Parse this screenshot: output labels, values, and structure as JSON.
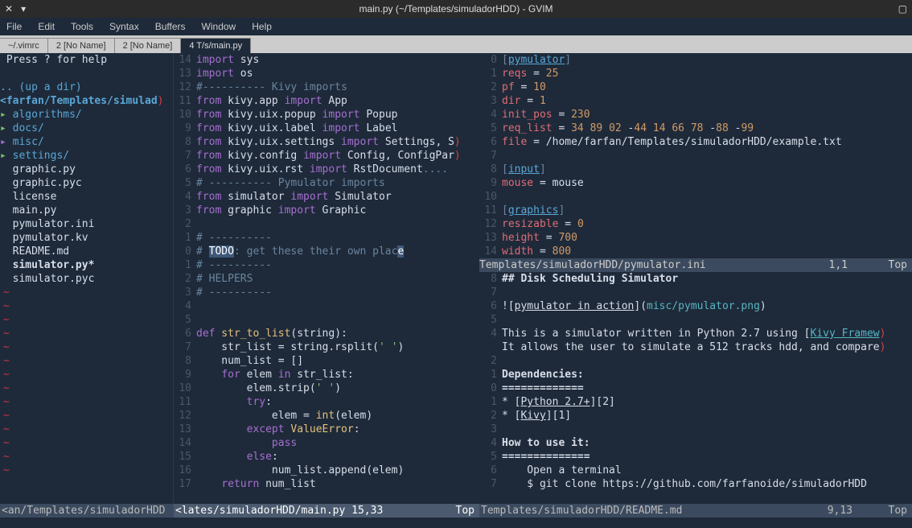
{
  "title": "main.py (~/Templates/simuladorHDD) - GVIM",
  "menus": [
    "File",
    "Edit",
    "Tools",
    "Syntax",
    "Buffers",
    "Window",
    "Help"
  ],
  "tabs": [
    "~/.vimrc",
    "2 [No Name]",
    "2 [No Name]",
    "4 T/s/main.py"
  ],
  "nerdtree": {
    "header": " Press ? for help",
    "updir": ".. (up a dir)",
    "path": "<farfan/Templates/simulad",
    "tree": [
      {
        "icon": "▸",
        "name": "algorithms/",
        "color": "blue",
        "iconcolor": "green"
      },
      {
        "icon": "▸",
        "name": "docs/",
        "color": "blue",
        "iconcolor": "green"
      },
      {
        "icon": "▸",
        "name": "misc/",
        "color": "blue",
        "iconcolor": "purple"
      },
      {
        "icon": "▸",
        "name": "settings/",
        "color": "blue",
        "iconcolor": "green"
      },
      {
        "icon": " ",
        "name": "graphic.py",
        "color": "white"
      },
      {
        "icon": " ",
        "name": "graphic.pyc",
        "color": "white"
      },
      {
        "icon": " ",
        "name": "license",
        "color": "white"
      },
      {
        "icon": " ",
        "name": "main.py",
        "color": "white"
      },
      {
        "icon": " ",
        "name": "pymulator.ini",
        "color": "white"
      },
      {
        "icon": " ",
        "name": "pymulator.kv",
        "color": "white"
      },
      {
        "icon": " ",
        "name": "README.md",
        "color": "white"
      },
      {
        "icon": " ",
        "name": "simulator.py*",
        "bold": true,
        "color": "white"
      },
      {
        "icon": " ",
        "name": "simulator.pyc",
        "color": "white"
      }
    ]
  },
  "main_code": [
    {
      "n": "14",
      "tokens": [
        [
          "purple",
          "import"
        ],
        [
          "white",
          " sys"
        ]
      ]
    },
    {
      "n": "13",
      "tokens": [
        [
          "purple",
          "import"
        ],
        [
          "white",
          " os"
        ]
      ]
    },
    {
      "n": "12",
      "tokens": [
        [
          "gray",
          "#---------- Kivy imports"
        ]
      ]
    },
    {
      "n": "11",
      "tokens": [
        [
          "purple",
          "from"
        ],
        [
          "white",
          " kivy.app "
        ],
        [
          "purple",
          "import"
        ],
        [
          "white",
          " App"
        ]
      ]
    },
    {
      "n": "10",
      "tokens": [
        [
          "purple",
          "from"
        ],
        [
          "white",
          " kivy.uix.popup "
        ],
        [
          "purple",
          "import"
        ],
        [
          "white",
          " Popup"
        ]
      ]
    },
    {
      "n": "9",
      "tokens": [
        [
          "purple",
          "from"
        ],
        [
          "white",
          " kivy.uix.label "
        ],
        [
          "purple",
          "import"
        ],
        [
          "white",
          " Label"
        ]
      ]
    },
    {
      "n": "8",
      "tokens": [
        [
          "purple",
          "from"
        ],
        [
          "white",
          " kivy.uix.settings "
        ],
        [
          "purple",
          "import"
        ],
        [
          "white",
          " Settings, S"
        ],
        [
          "rmark",
          ")"
        ]
      ]
    },
    {
      "n": "7",
      "tokens": [
        [
          "purple",
          "from"
        ],
        [
          "white",
          " kivy.config "
        ],
        [
          "purple",
          "import"
        ],
        [
          "white",
          " Config, ConfigPar"
        ],
        [
          "rmark",
          ")"
        ]
      ]
    },
    {
      "n": "6",
      "tokens": [
        [
          "purple",
          "from"
        ],
        [
          "white",
          " kivy.uix.rst "
        ],
        [
          "purple",
          "import"
        ],
        [
          "white",
          " RstDocument"
        ],
        [
          "gray",
          "...."
        ]
      ]
    },
    {
      "n": "5",
      "tokens": [
        [
          "gray",
          "# ---------- Pymulator imports"
        ]
      ]
    },
    {
      "n": "4",
      "tokens": [
        [
          "purple",
          "from"
        ],
        [
          "white",
          " simulator "
        ],
        [
          "purple",
          "import"
        ],
        [
          "white",
          " Simulator"
        ]
      ]
    },
    {
      "n": "3",
      "tokens": [
        [
          "purple",
          "from"
        ],
        [
          "white",
          " graphic "
        ],
        [
          "purple",
          "import"
        ],
        [
          "white",
          " Graphic"
        ]
      ]
    },
    {
      "n": "2",
      "tokens": []
    },
    {
      "n": "1",
      "tokens": [
        [
          "gray",
          "# ----------"
        ]
      ]
    },
    {
      "n": "0",
      "tokens": [
        [
          "gray",
          "# "
        ],
        [
          "sel",
          "TODO"
        ],
        [
          "gray",
          ": get these their own plac"
        ],
        [
          "sel",
          "e"
        ]
      ]
    },
    {
      "n": "1",
      "tokens": [
        [
          "gray",
          "# ----------"
        ]
      ]
    },
    {
      "n": "2",
      "tokens": [
        [
          "gray",
          "# HELPERS"
        ]
      ]
    },
    {
      "n": "3",
      "tokens": [
        [
          "gray",
          "# ----------"
        ]
      ]
    },
    {
      "n": "4",
      "tokens": []
    },
    {
      "n": "5",
      "tokens": []
    },
    {
      "n": "6",
      "tokens": [
        [
          "purple",
          "def"
        ],
        [
          "yellow",
          " str_to_list"
        ],
        [
          "white",
          "(string):"
        ]
      ]
    },
    {
      "n": "7",
      "tokens": [
        [
          "white",
          "    str_list = string.rsplit("
        ],
        [
          "green",
          "' '"
        ],
        [
          "white",
          ")"
        ]
      ]
    },
    {
      "n": "8",
      "tokens": [
        [
          "white",
          "    num_list = []"
        ]
      ]
    },
    {
      "n": "9",
      "tokens": [
        [
          "white",
          "    "
        ],
        [
          "purple",
          "for"
        ],
        [
          "white",
          " elem "
        ],
        [
          "purple",
          "in"
        ],
        [
          "white",
          " str_list:"
        ]
      ]
    },
    {
      "n": "10",
      "tokens": [
        [
          "white",
          "        elem.strip("
        ],
        [
          "green",
          "' '"
        ],
        [
          "white",
          ")"
        ]
      ]
    },
    {
      "n": "11",
      "tokens": [
        [
          "white",
          "        "
        ],
        [
          "purple",
          "try"
        ],
        [
          "white",
          ":"
        ]
      ]
    },
    {
      "n": "12",
      "tokens": [
        [
          "white",
          "            elem = "
        ],
        [
          "yellow",
          "int"
        ],
        [
          "white",
          "(elem)"
        ]
      ]
    },
    {
      "n": "13",
      "tokens": [
        [
          "white",
          "        "
        ],
        [
          "purple",
          "except"
        ],
        [
          "yellow",
          " ValueError"
        ],
        [
          "white",
          ":"
        ]
      ]
    },
    {
      "n": "14",
      "tokens": [
        [
          "white",
          "            "
        ],
        [
          "purple",
          "pass"
        ]
      ]
    },
    {
      "n": "15",
      "tokens": [
        [
          "white",
          "        "
        ],
        [
          "purple",
          "else"
        ],
        [
          "white",
          ":"
        ]
      ]
    },
    {
      "n": "16",
      "tokens": [
        [
          "white",
          "            num_list.append(elem)"
        ]
      ]
    },
    {
      "n": "17",
      "tokens": [
        [
          "white",
          "    "
        ],
        [
          "purple",
          "return"
        ],
        [
          "white",
          " num_list"
        ]
      ]
    }
  ],
  "ini_code": [
    {
      "n": "0",
      "tokens": [
        [
          "gray",
          "["
        ],
        [
          "blue underline",
          "pymulator"
        ],
        [
          "gray",
          "]"
        ]
      ]
    },
    {
      "n": "1",
      "tokens": [
        [
          "red",
          "reqs"
        ],
        [
          "white",
          " = "
        ],
        [
          "orange",
          "25"
        ]
      ]
    },
    {
      "n": "2",
      "tokens": [
        [
          "red",
          "pf"
        ],
        [
          "white",
          " = "
        ],
        [
          "orange",
          "10"
        ]
      ]
    },
    {
      "n": "3",
      "tokens": [
        [
          "red",
          "dir"
        ],
        [
          "white",
          " = "
        ],
        [
          "orange",
          "1"
        ]
      ]
    },
    {
      "n": "4",
      "tokens": [
        [
          "red",
          "init_pos"
        ],
        [
          "white",
          " = "
        ],
        [
          "orange",
          "230"
        ]
      ]
    },
    {
      "n": "5",
      "tokens": [
        [
          "red",
          "req_list"
        ],
        [
          "white",
          " = "
        ],
        [
          "orange",
          "34 89 02"
        ],
        [
          "white",
          " -"
        ],
        [
          "orange",
          "44 14 66 78"
        ],
        [
          "white",
          " -"
        ],
        [
          "orange",
          "88"
        ],
        [
          "white",
          " -"
        ],
        [
          "orange",
          "99"
        ]
      ]
    },
    {
      "n": "6",
      "tokens": [
        [
          "red",
          "file"
        ],
        [
          "white",
          " = /home/farfan/Templates/simuladorHDD/example.txt"
        ]
      ]
    },
    {
      "n": "7",
      "tokens": []
    },
    {
      "n": "8",
      "tokens": [
        [
          "gray",
          "["
        ],
        [
          "blue underline",
          "input"
        ],
        [
          "gray",
          "]"
        ]
      ]
    },
    {
      "n": "9",
      "tokens": [
        [
          "red",
          "mouse"
        ],
        [
          "white",
          " = mouse"
        ]
      ]
    },
    {
      "n": "10",
      "tokens": []
    },
    {
      "n": "11",
      "tokens": [
        [
          "gray",
          "["
        ],
        [
          "blue underline",
          "graphics"
        ],
        [
          "gray",
          "]"
        ]
      ]
    },
    {
      "n": "12",
      "tokens": [
        [
          "red",
          "resizable"
        ],
        [
          "white",
          " = "
        ],
        [
          "orange",
          "0"
        ]
      ]
    },
    {
      "n": "13",
      "tokens": [
        [
          "red",
          "height"
        ],
        [
          "white",
          " = "
        ],
        [
          "orange",
          "700"
        ]
      ]
    },
    {
      "n": "14",
      "tokens": [
        [
          "red",
          "width"
        ],
        [
          "white",
          " = "
        ],
        [
          "orange",
          "800"
        ]
      ]
    }
  ],
  "ini_status": {
    "path": "Templates/simuladorHDD/pymulator.ini",
    "pos": "1,1",
    "pct": "Top"
  },
  "readme": [
    {
      "n": "8",
      "tokens": [
        [
          "white bold",
          "## Disk Scheduling Simulator"
        ]
      ]
    },
    {
      "n": "7",
      "tokens": []
    },
    {
      "n": "6",
      "tokens": [
        [
          "white",
          "!["
        ],
        [
          "white underline",
          "pymulator in action"
        ],
        [
          "white",
          "]("
        ],
        [
          "cyan",
          "misc/pymulator.png"
        ],
        [
          "white",
          ")"
        ]
      ]
    },
    {
      "n": "5",
      "tokens": []
    },
    {
      "n": "4",
      "tokens": [
        [
          "white",
          "This is a simulator written in Python 2.7 using ["
        ],
        [
          "cyan underline",
          "Kivy Framew"
        ],
        [
          "rmark",
          ")"
        ]
      ]
    },
    {
      "n": "",
      "tokens": [
        [
          "white",
          "It allows the user to simulate a 512 tracks hdd, and compare"
        ],
        [
          "rmark",
          ")"
        ]
      ]
    },
    {
      "n": "2",
      "tokens": []
    },
    {
      "n": "1",
      "tokens": [
        [
          "white bold",
          "Dependencies:"
        ]
      ]
    },
    {
      "n": "0",
      "tokens": [
        [
          "white bold",
          "============="
        ]
      ]
    },
    {
      "n": "1",
      "tokens": [
        [
          "white",
          "* ["
        ],
        [
          "white underline",
          "Python 2.7+"
        ],
        [
          "white",
          "][2]"
        ]
      ]
    },
    {
      "n": "2",
      "tokens": [
        [
          "white",
          "* ["
        ],
        [
          "white underline",
          "Kivy"
        ],
        [
          "white",
          "][1]"
        ]
      ]
    },
    {
      "n": "3",
      "tokens": []
    },
    {
      "n": "4",
      "tokens": [
        [
          "white bold",
          "How to use it:"
        ]
      ]
    },
    {
      "n": "5",
      "tokens": [
        [
          "white bold",
          "=============="
        ]
      ]
    },
    {
      "n": "6",
      "tokens": [
        [
          "white",
          "    Open a terminal"
        ]
      ]
    },
    {
      "n": "7",
      "tokens": [
        [
          "white",
          "    $ git clone https://github.com/farfanoide/simuladorHDD"
        ]
      ]
    }
  ],
  "status": {
    "left": "<an/Templates/simuladorHDD",
    "mid": "<lates/simuladorHDD/main.py 15,33",
    "midpct": "Top",
    "readme": "Templates/simuladorHDD/README.md",
    "readmepos": "9,13",
    "readmepct": "Top"
  }
}
